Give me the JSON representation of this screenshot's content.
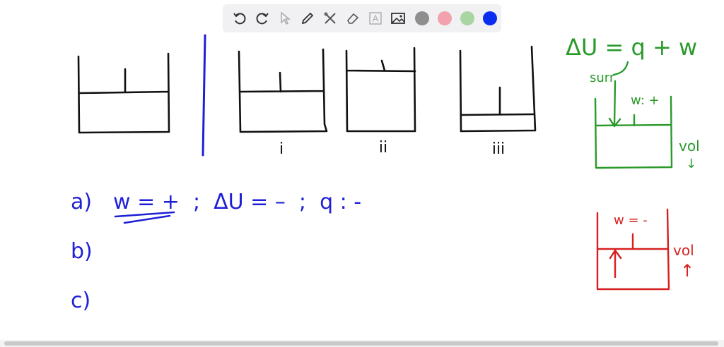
{
  "toolbar": {
    "tools": [
      {
        "name": "undo-icon",
        "label": "Undo"
      },
      {
        "name": "redo-icon",
        "label": "Redo"
      },
      {
        "name": "pointer-icon",
        "label": "Select"
      },
      {
        "name": "pen-icon",
        "label": "Pen"
      },
      {
        "name": "tools-icon",
        "label": "Tools"
      },
      {
        "name": "eraser-icon",
        "label": "Eraser"
      },
      {
        "name": "text-icon",
        "label": "Text"
      },
      {
        "name": "image-icon",
        "label": "Image"
      }
    ],
    "text_tool_glyph": "A",
    "colors": [
      "#8e8e8e",
      "#f2a2ad",
      "#a8d5a2",
      "#0a2cf0"
    ]
  },
  "board": {
    "colors": {
      "black": "#111111",
      "blue": "#1f1fd6",
      "green": "#2a9a2a",
      "red": "#d62020"
    },
    "diagram_labels": {
      "i": "i",
      "ii": "ii",
      "iii": "iii"
    },
    "green_note": {
      "equation": "ΔU = q + w",
      "surr": "surr",
      "work": "w: +",
      "vol": "vol",
      "vol_arrow": "↓"
    },
    "red_note": {
      "work": "w = -",
      "vol": "vol",
      "vol_arrow": "↑"
    },
    "answers": {
      "a_label": "a)",
      "a_text": "w = +  ;  ΔU = –  ;  q : -",
      "b_label": "b)",
      "c_label": "c)"
    }
  }
}
